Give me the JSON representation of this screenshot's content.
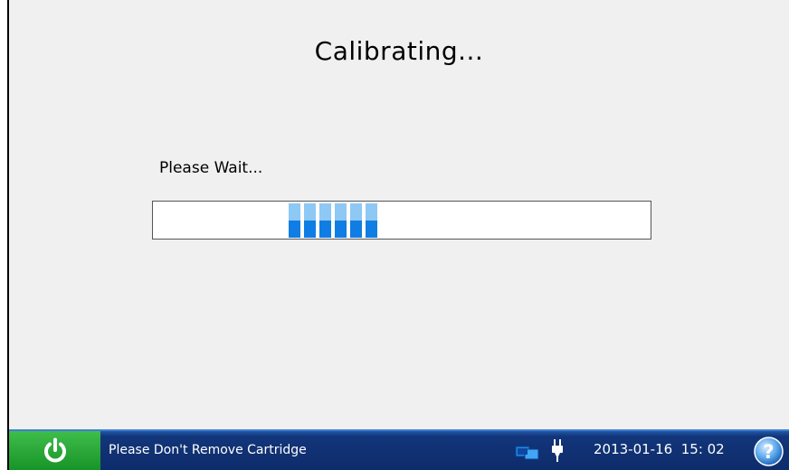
{
  "dialog": {
    "title": "Calibrating...",
    "message": "Please Wait...",
    "progress_segments": 6
  },
  "taskbar": {
    "status_message": "Please Don't Remove Cartridge",
    "date": "2013-01-16",
    "time": "15: 02",
    "icons": {
      "power": "power-icon",
      "network": "network-icon",
      "plug": "plug-icon",
      "help": "help-icon"
    }
  },
  "colors": {
    "background": "#f0f0f0",
    "progress_segment_light": "#8ec8f5",
    "progress_segment_dark": "#0f7de3",
    "taskbar": "#12357a",
    "power_button": "#2aa83a"
  }
}
